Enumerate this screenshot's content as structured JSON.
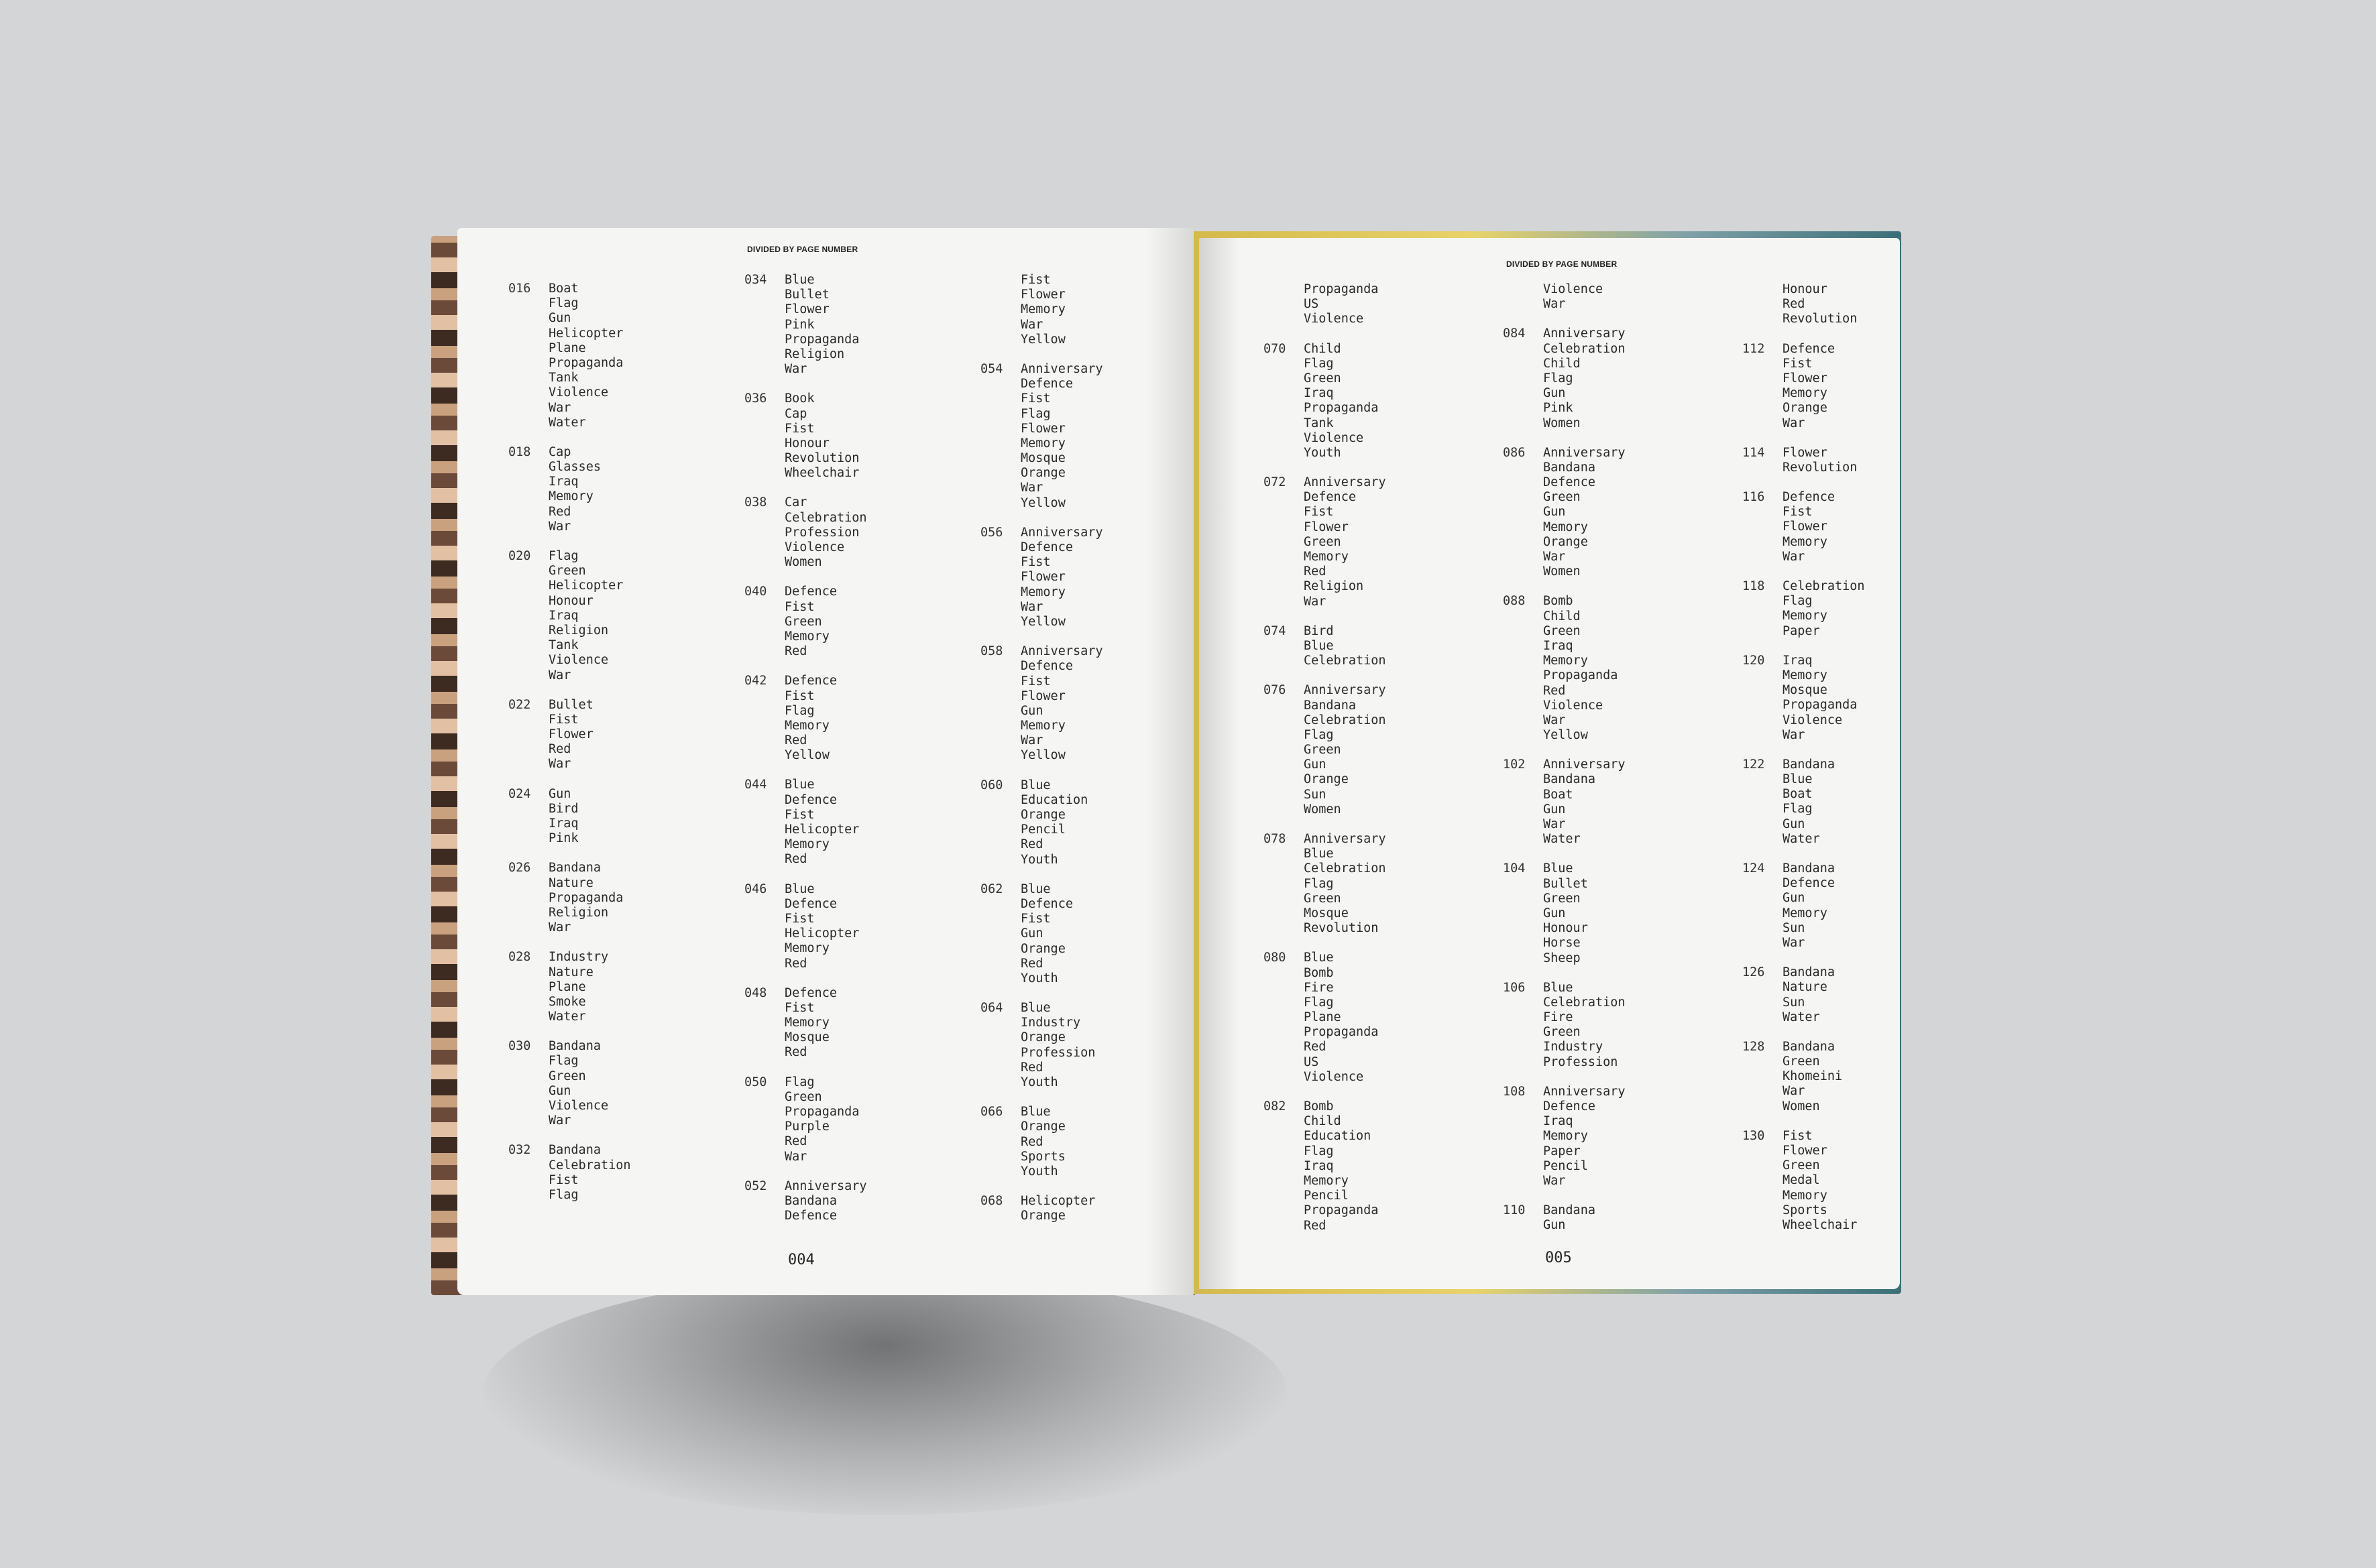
{
  "left_page": {
    "running_head": "DIVIDED BY PAGE NUMBER",
    "folio": "004",
    "columns": [
      [
        {
          "num": "016",
          "terms": [
            "Boat",
            "Flag",
            "Gun",
            "Helicopter",
            "Plane",
            "Propaganda",
            "Tank",
            "Violence",
            "War",
            "Water"
          ]
        },
        {
          "num": "018",
          "terms": [
            "Cap",
            "Glasses",
            "Iraq",
            "Memory",
            "Red",
            "War"
          ]
        },
        {
          "num": "020",
          "terms": [
            "Flag",
            "Green",
            "Helicopter",
            "Honour",
            "Iraq",
            "Religion",
            "Tank",
            "Violence",
            "War"
          ]
        },
        {
          "num": "022",
          "terms": [
            "Bullet",
            "Fist",
            "Flower",
            "Red",
            "War"
          ]
        },
        {
          "num": "024",
          "terms": [
            "Gun",
            "Bird",
            "Iraq",
            "Pink"
          ]
        },
        {
          "num": "026",
          "terms": [
            "Bandana",
            "Nature",
            "Propaganda",
            "Religion",
            "War"
          ]
        },
        {
          "num": "028",
          "terms": [
            "Industry",
            "Nature",
            "Plane",
            "Smoke",
            "Water"
          ]
        },
        {
          "num": "030",
          "terms": [
            "Bandana",
            "Flag",
            "Green",
            "Gun",
            "Violence",
            "War"
          ]
        },
        {
          "num": "032",
          "terms": [
            "Bandana",
            "Celebration",
            "Fist",
            "Flag"
          ]
        }
      ],
      [
        {
          "num": "034",
          "terms": [
            "Blue",
            "Bullet",
            "Flower",
            "Pink",
            "Propaganda",
            "Religion",
            "War"
          ]
        },
        {
          "num": "036",
          "terms": [
            "Book",
            "Cap",
            "Fist",
            "Honour",
            "Revolution",
            "Wheelchair"
          ]
        },
        {
          "num": "038",
          "terms": [
            "Car",
            "Celebration",
            "Profession",
            "Violence",
            "Women"
          ]
        },
        {
          "num": "040",
          "terms": [
            "Defence",
            "Fist",
            "Green",
            "Memory",
            "Red"
          ]
        },
        {
          "num": "042",
          "terms": [
            "Defence",
            "Fist",
            "Flag",
            "Memory",
            "Red",
            "Yellow"
          ]
        },
        {
          "num": "044",
          "terms": [
            "Blue",
            "Defence",
            "Fist",
            "Helicopter",
            "Memory",
            "Red"
          ]
        },
        {
          "num": "046",
          "terms": [
            "Blue",
            "Defence",
            "Fist",
            "Helicopter",
            "Memory",
            "Red"
          ]
        },
        {
          "num": "048",
          "terms": [
            "Defence",
            "Fist",
            "Memory",
            "Mosque",
            "Red"
          ]
        },
        {
          "num": "050",
          "terms": [
            "Flag",
            "Green",
            "Propaganda",
            "Purple",
            "Red",
            "War"
          ]
        },
        {
          "num": "052",
          "terms": [
            "Anniversary",
            "Bandana",
            "Defence"
          ]
        }
      ],
      [
        {
          "num": "",
          "terms": [
            "Fist",
            "Flower",
            "Memory",
            "War",
            "Yellow"
          ]
        },
        {
          "num": "054",
          "terms": [
            "Anniversary",
            "Defence",
            "Fist",
            "Flag",
            "Flower",
            "Memory",
            "Mosque",
            "Orange",
            "War",
            "Yellow"
          ]
        },
        {
          "num": "056",
          "terms": [
            "Anniversary",
            "Defence",
            "Fist",
            "Flower",
            "Memory",
            "War",
            "Yellow"
          ]
        },
        {
          "num": "058",
          "terms": [
            "Anniversary",
            "Defence",
            "Fist",
            "Flower",
            "Gun",
            "Memory",
            "War",
            "Yellow"
          ]
        },
        {
          "num": "060",
          "terms": [
            "Blue",
            "Education",
            "Orange",
            "Pencil",
            "Red",
            "Youth"
          ]
        },
        {
          "num": "062",
          "terms": [
            "Blue",
            "Defence",
            "Fist",
            "Gun",
            "Orange",
            "Red",
            "Youth"
          ]
        },
        {
          "num": "064",
          "terms": [
            "Blue",
            "Industry",
            "Orange",
            "Profession",
            "Red",
            "Youth"
          ]
        },
        {
          "num": "066",
          "terms": [
            "Blue",
            "Orange",
            "Red",
            "Sports",
            "Youth"
          ]
        },
        {
          "num": "068",
          "terms": [
            "Helicopter",
            "Orange"
          ]
        }
      ]
    ]
  },
  "right_page": {
    "running_head": "DIVIDED BY PAGE NUMBER",
    "folio": "005",
    "columns": [
      [
        {
          "num": "",
          "terms": [
            "Propaganda",
            "US",
            "Violence"
          ]
        },
        {
          "num": "070",
          "terms": [
            "Child",
            "Flag",
            "Green",
            "Iraq",
            "Propaganda",
            "Tank",
            "Violence",
            "Youth"
          ]
        },
        {
          "num": "072",
          "terms": [
            "Anniversary",
            "Defence",
            "Fist",
            "Flower",
            "Green",
            "Memory",
            "Red",
            "Religion",
            "War"
          ]
        },
        {
          "num": "074",
          "terms": [
            "Bird",
            "Blue",
            "Celebration"
          ]
        },
        {
          "num": "076",
          "terms": [
            "Anniversary",
            "Bandana",
            "Celebration",
            "Flag",
            "Green",
            "Gun",
            "Orange",
            "Sun",
            "Women"
          ]
        },
        {
          "num": "078",
          "terms": [
            "Anniversary",
            "Blue",
            "Celebration",
            "Flag",
            "Green",
            "Mosque",
            "Revolution"
          ]
        },
        {
          "num": "080",
          "terms": [
            "Blue",
            "Bomb",
            "Fire",
            "Flag",
            "Plane",
            "Propaganda",
            "Red",
            "US",
            "Violence"
          ]
        },
        {
          "num": "082",
          "terms": [
            "Bomb",
            "Child",
            "Education",
            "Flag",
            "Iraq",
            "Memory",
            "Pencil",
            "Propaganda",
            "Red"
          ]
        }
      ],
      [
        {
          "num": "",
          "terms": [
            "Violence",
            "War"
          ]
        },
        {
          "num": "084",
          "terms": [
            "Anniversary",
            "Celebration",
            "Child",
            "Flag",
            "Gun",
            "Pink",
            "Women"
          ]
        },
        {
          "num": "086",
          "terms": [
            "Anniversary",
            "Bandana",
            "Defence",
            "Green",
            "Gun",
            "Memory",
            "Orange",
            "War",
            "Women"
          ]
        },
        {
          "num": "088",
          "terms": [
            "Bomb",
            "Child",
            "Green",
            "Iraq",
            "Memory",
            "Propaganda",
            "Red",
            "Violence",
            "War",
            "Yellow"
          ]
        },
        {
          "num": "102",
          "terms": [
            "Anniversary",
            "Bandana",
            "Boat",
            "Gun",
            "War",
            "Water"
          ]
        },
        {
          "num": "104",
          "terms": [
            "Blue",
            "Bullet",
            "Green",
            "Gun",
            "Honour",
            "Horse",
            "Sheep"
          ]
        },
        {
          "num": "106",
          "terms": [
            "Blue",
            "Celebration",
            "Fire",
            "Green",
            "Industry",
            "Profession"
          ]
        },
        {
          "num": "108",
          "terms": [
            "Anniversary",
            "Defence",
            "Iraq",
            "Memory",
            "Paper",
            "Pencil",
            "War"
          ]
        },
        {
          "num": "110",
          "terms": [
            "Bandana",
            "Gun"
          ]
        }
      ],
      [
        {
          "num": "",
          "terms": [
            "Honour",
            "Red",
            "Revolution"
          ]
        },
        {
          "num": "112",
          "terms": [
            "Defence",
            "Fist",
            "Flower",
            "Memory",
            "Orange",
            "War"
          ]
        },
        {
          "num": "114",
          "terms": [
            "Flower",
            "Revolution"
          ]
        },
        {
          "num": "116",
          "terms": [
            "Defence",
            "Fist",
            "Flower",
            "Memory",
            "War"
          ]
        },
        {
          "num": "118",
          "terms": [
            "Celebration",
            "Flag",
            "Memory",
            "Paper"
          ]
        },
        {
          "num": "120",
          "terms": [
            "Iraq",
            "Memory",
            "Mosque",
            "Propaganda",
            "Violence",
            "War"
          ]
        },
        {
          "num": "122",
          "terms": [
            "Bandana",
            "Blue",
            "Boat",
            "Flag",
            "Gun",
            "Water"
          ]
        },
        {
          "num": "124",
          "terms": [
            "Bandana",
            "Defence",
            "Gun",
            "Memory",
            "Sun",
            "War"
          ]
        },
        {
          "num": "126",
          "terms": [
            "Bandana",
            "Nature",
            "Sun",
            "Water"
          ]
        },
        {
          "num": "128",
          "terms": [
            "Bandana",
            "Green",
            "Khomeini",
            "War",
            "Women"
          ]
        },
        {
          "num": "130",
          "terms": [
            "Fist",
            "Flower",
            "Green",
            "Medal",
            "Memory",
            "Sports",
            "Wheelchair"
          ]
        }
      ]
    ]
  }
}
